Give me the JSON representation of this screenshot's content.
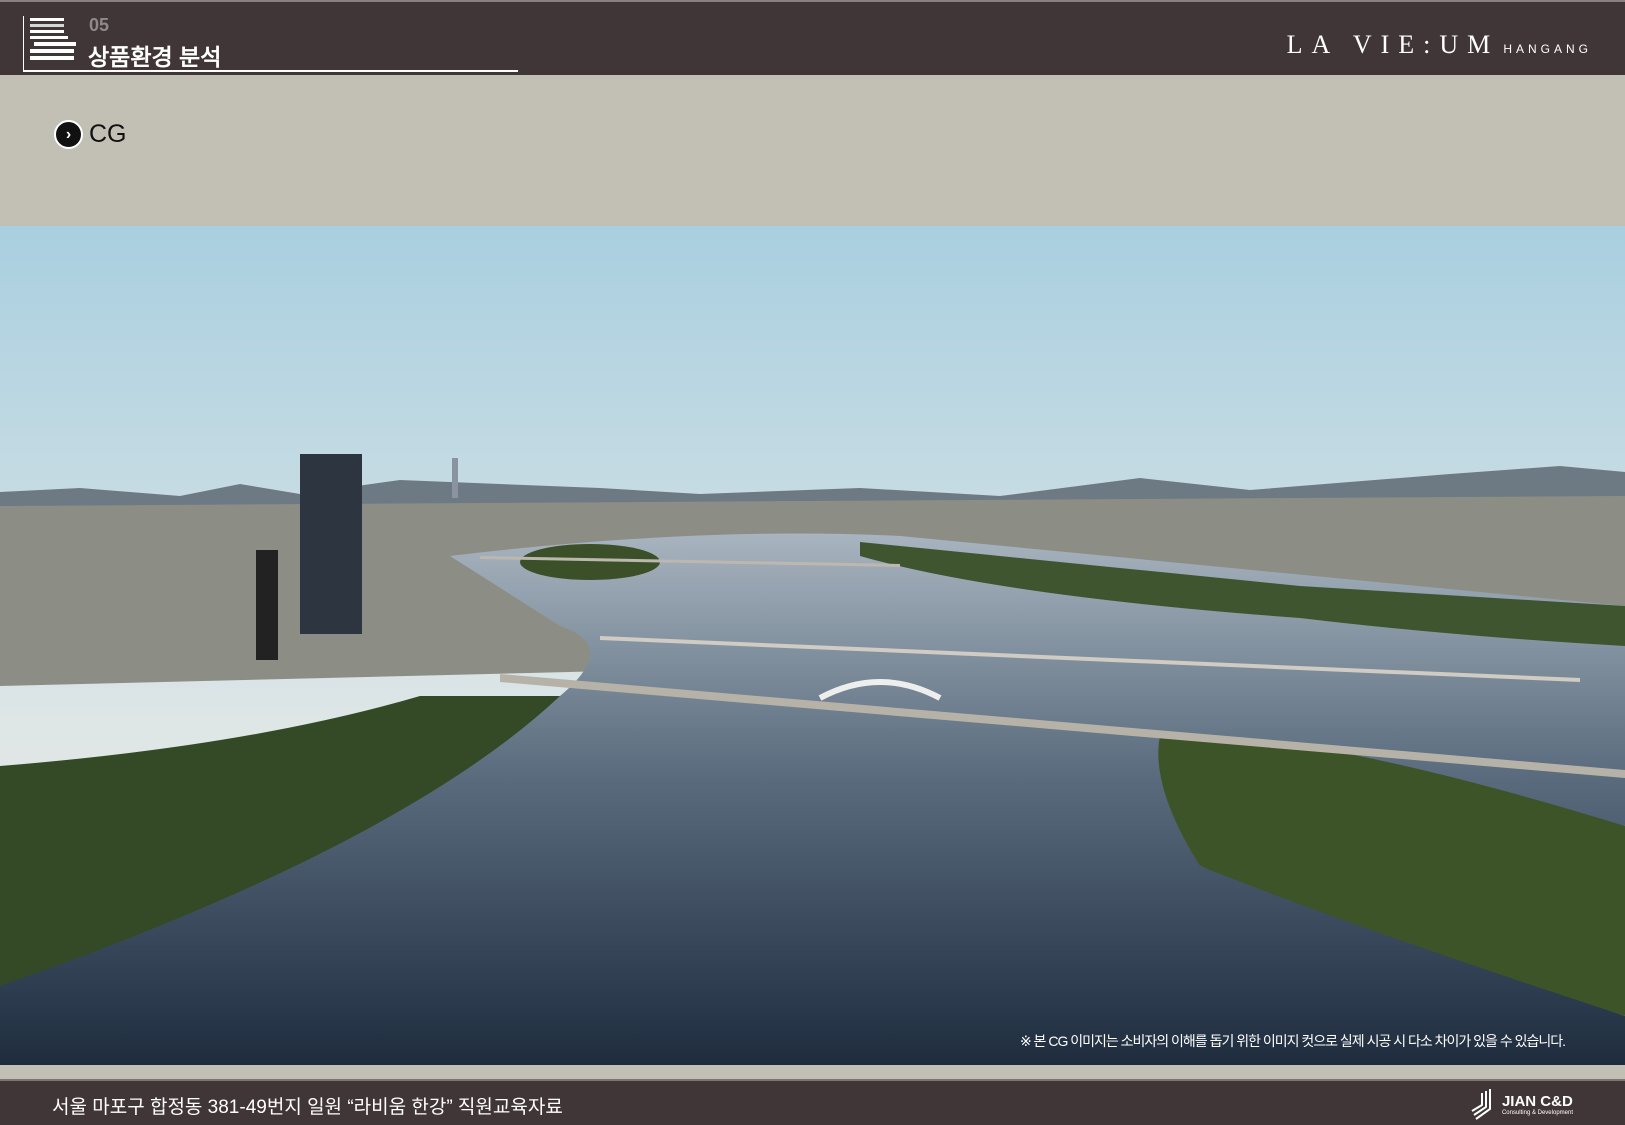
{
  "header": {
    "section_number": "05",
    "section_title": "상품환경 분석",
    "brand": "LA VIE:UM",
    "brand_sub": "HANGANG"
  },
  "band": {
    "label": "CG"
  },
  "photo": {
    "disclaimer": "※ 본 CG 이미지는 소비자의 이해를 돕기 위한 이미지 컷으로 실제 시공 시 다소 차이가 있을 수 있습니다."
  },
  "footer": {
    "text": "서울 마포구 합정동 381-49번지 일원 “라비움 한강” 직원교육자료",
    "company": "JIAN C&D",
    "company_sub": "Consulting & Development"
  },
  "colors": {
    "header_bg": "#413637",
    "band_bg": "#c2c0b4"
  }
}
